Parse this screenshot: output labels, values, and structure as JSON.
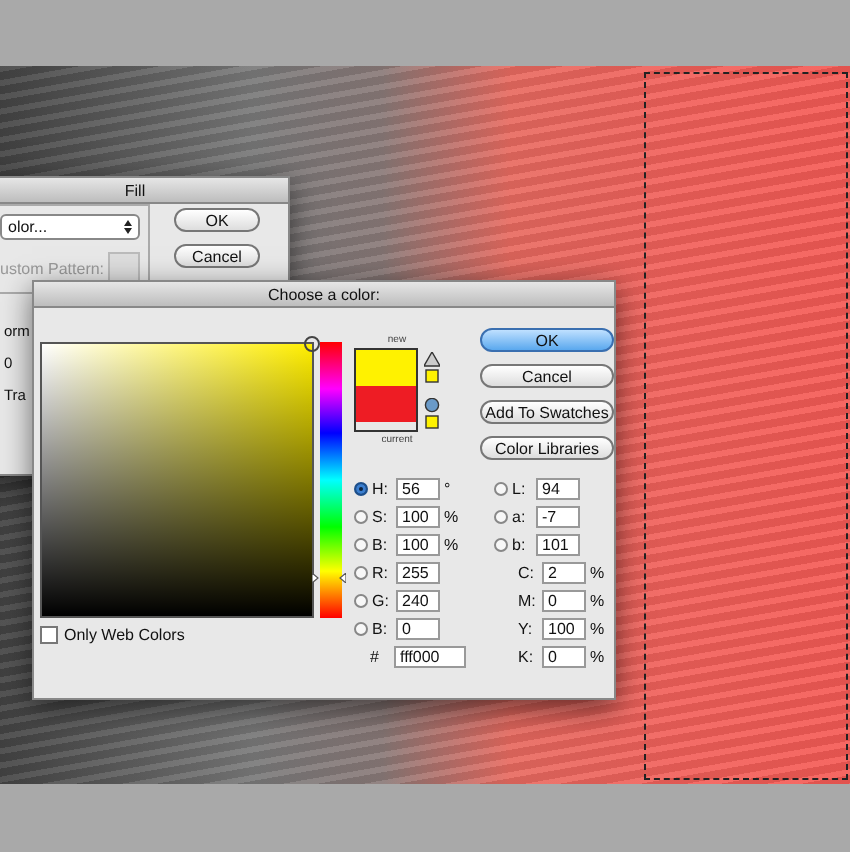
{
  "fill_dialog": {
    "title": "Fill",
    "contents_dropdown": "olor...",
    "custom_pattern_label": "ustom Pattern:",
    "buttons": [
      {
        "label": "OK"
      },
      {
        "label": "Cancel"
      }
    ],
    "partial_labels": [
      "orm",
      "0",
      "Tra"
    ]
  },
  "color_picker": {
    "title": "Choose a color:",
    "hue_slider": {
      "level": 0.16
    },
    "swatches": [
      {
        "label": "new",
        "color": "#fff200"
      },
      {
        "label": "current",
        "color": "#ee1c24"
      }
    ],
    "buttons": [
      {
        "label": "OK",
        "kind": "default"
      },
      {
        "label": "Cancel",
        "kind": "normal"
      },
      {
        "label": "Add To Swatches",
        "kind": "normal"
      },
      {
        "label": "Color Libraries",
        "kind": "normal"
      }
    ],
    "hsb": [
      {
        "label": "H:",
        "value": "56",
        "unit": "°",
        "selected": true
      },
      {
        "label": "S:",
        "value": "100",
        "unit": "%",
        "selected": false
      },
      {
        "label": "B:",
        "value": "100",
        "unit": "%",
        "selected": false
      }
    ],
    "lab": [
      {
        "label": "L:",
        "value": "94",
        "selected": false
      },
      {
        "label": "a:",
        "value": "-7",
        "selected": false
      },
      {
        "label": "b:",
        "value": "101",
        "selected": false
      }
    ],
    "rgb": [
      {
        "label": "R:",
        "value": "255",
        "selected": false
      },
      {
        "label": "G:",
        "value": "240",
        "selected": false
      },
      {
        "label": "B:",
        "value": "0",
        "selected": false
      }
    ],
    "cmyk": [
      {
        "label": "C:",
        "value": "2",
        "unit": "%"
      },
      {
        "label": "M:",
        "value": "0",
        "unit": "%"
      },
      {
        "label": "Y:",
        "value": "100",
        "unit": "%"
      },
      {
        "label": "K:",
        "value": "0",
        "unit": "%"
      }
    ],
    "hex": {
      "label": "#",
      "value": "fff000"
    },
    "only_web_colors": {
      "label": "Only Web Colors",
      "checked": false
    }
  }
}
